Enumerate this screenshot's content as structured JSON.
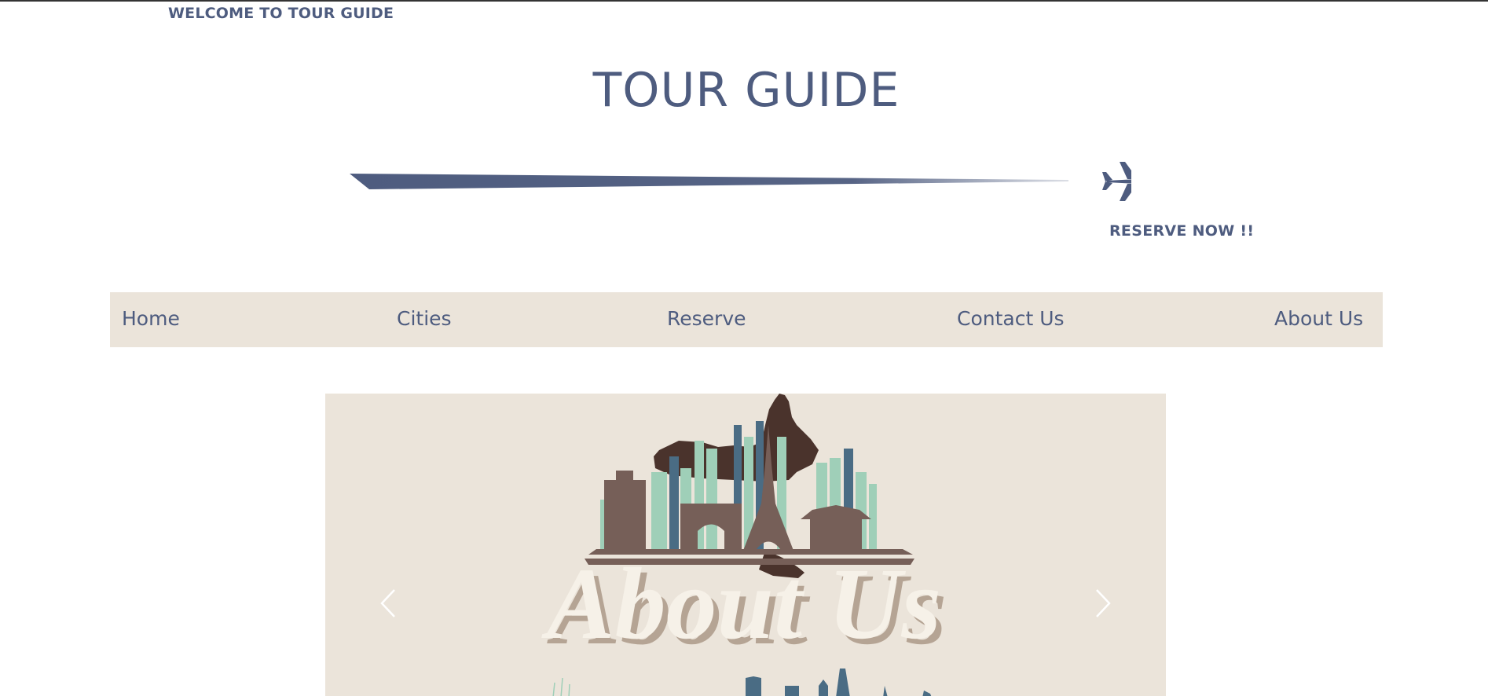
{
  "header": {
    "welcome_text": "WELCOME TO TOUR GUIDE",
    "site_title": "TOUR GUIDE",
    "reserve_cta": "RESERVE NOW !!"
  },
  "nav": {
    "items": [
      {
        "label": "Home"
      },
      {
        "label": "Cities"
      },
      {
        "label": "Reserve"
      },
      {
        "label": "Contact Us"
      },
      {
        "label": "About Us"
      }
    ]
  },
  "slider": {
    "current_slide": {
      "heading": "About Us"
    },
    "prev_icon": "chevron-left-icon",
    "next_icon": "chevron-right-icon"
  },
  "colors": {
    "primary": "#4e5c7f",
    "nav_background": "#ebe4da",
    "slide_background": "#ebe4da",
    "skyline_brown": "#765f58",
    "skyline_dark": "#4a332c",
    "skyline_mint": "#9fcfb8",
    "skyline_blue": "#4a6c84",
    "heading_cream": "#f6f1e8",
    "heading_shadow": "#b5a494"
  }
}
